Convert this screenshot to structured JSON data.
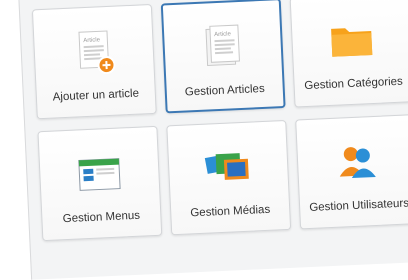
{
  "tiles": [
    {
      "label": "Ajouter un article",
      "icon": "add-article-icon"
    },
    {
      "label": "Gestion Articles",
      "icon": "articles-icon",
      "selected": true
    },
    {
      "label": "Gestion Catégories",
      "icon": "folder-icon"
    },
    {
      "label": "Gestion Menus",
      "icon": "menu-window-icon"
    },
    {
      "label": "Gestion Médias",
      "icon": "media-icon"
    },
    {
      "label": "Gestion Utilisateurs",
      "icon": "users-icon"
    }
  ],
  "icon_text": "Article",
  "colors": {
    "selected_border": "#3c78b4",
    "add_badge": "#f08a1c",
    "folder": "#f7a21b",
    "users_orange": "#f08a1c",
    "users_blue": "#2b8fd6"
  }
}
